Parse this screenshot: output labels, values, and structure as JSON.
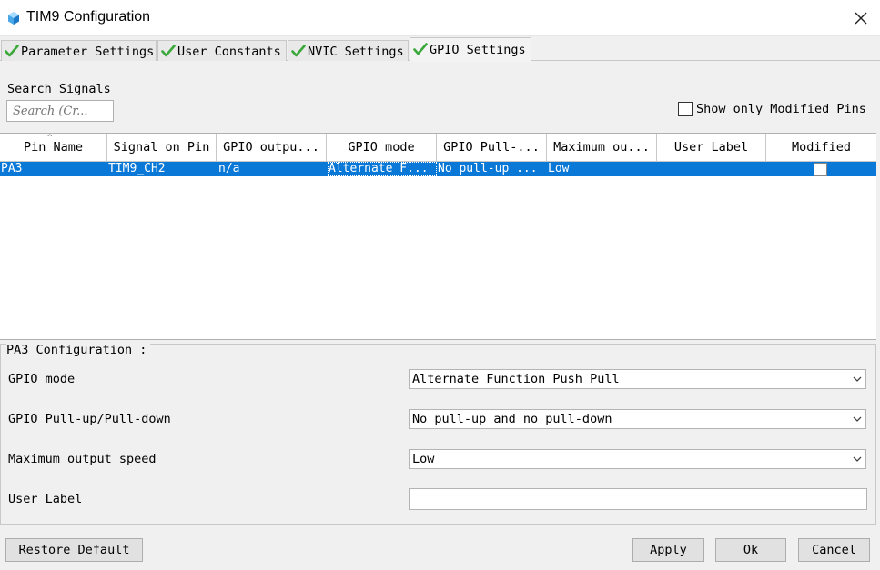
{
  "window": {
    "title": "TIM9 Configuration"
  },
  "tabs": [
    {
      "label": "Parameter Settings",
      "checked": true,
      "active": false
    },
    {
      "label": "User Constants",
      "checked": true,
      "active": false
    },
    {
      "label": "NVIC Settings",
      "checked": true,
      "active": false
    },
    {
      "label": "GPIO Settings",
      "checked": true,
      "active": true
    }
  ],
  "search": {
    "label": "Search Signals",
    "placeholder": "Search (Cr..."
  },
  "show_only": {
    "label": "Show only Modified Pins",
    "checked": false
  },
  "table": {
    "columns": [
      "Pin Name",
      "Signal on Pin",
      "GPIO outpu...",
      "GPIO mode",
      "GPIO Pull-...",
      "Maximum ou...",
      "User Label",
      "Modified"
    ],
    "rows": [
      {
        "pin": "PA3",
        "signal": "TIM9_CH2",
        "output": "n/a",
        "mode": "Alternate F...",
        "pull": "No pull-up ...",
        "speed": "Low",
        "user_label": "",
        "modified": false,
        "selected": true
      }
    ]
  },
  "config": {
    "title": "PA3 Configuration :",
    "gpio_mode": {
      "label": "GPIO mode",
      "value": "Alternate Function Push Pull"
    },
    "pull": {
      "label": "GPIO Pull-up/Pull-down",
      "value": "No pull-up and no pull-down"
    },
    "speed": {
      "label": "Maximum output speed",
      "value": "Low"
    },
    "user_label": {
      "label": "User Label",
      "value": ""
    }
  },
  "buttons": {
    "restore": "Restore Default",
    "apply": "Apply",
    "ok": "Ok",
    "cancel": "Cancel"
  },
  "colors": {
    "selection": "#0a78d7",
    "check": "#3aa83a",
    "accent_icon": "#1e88e5"
  }
}
